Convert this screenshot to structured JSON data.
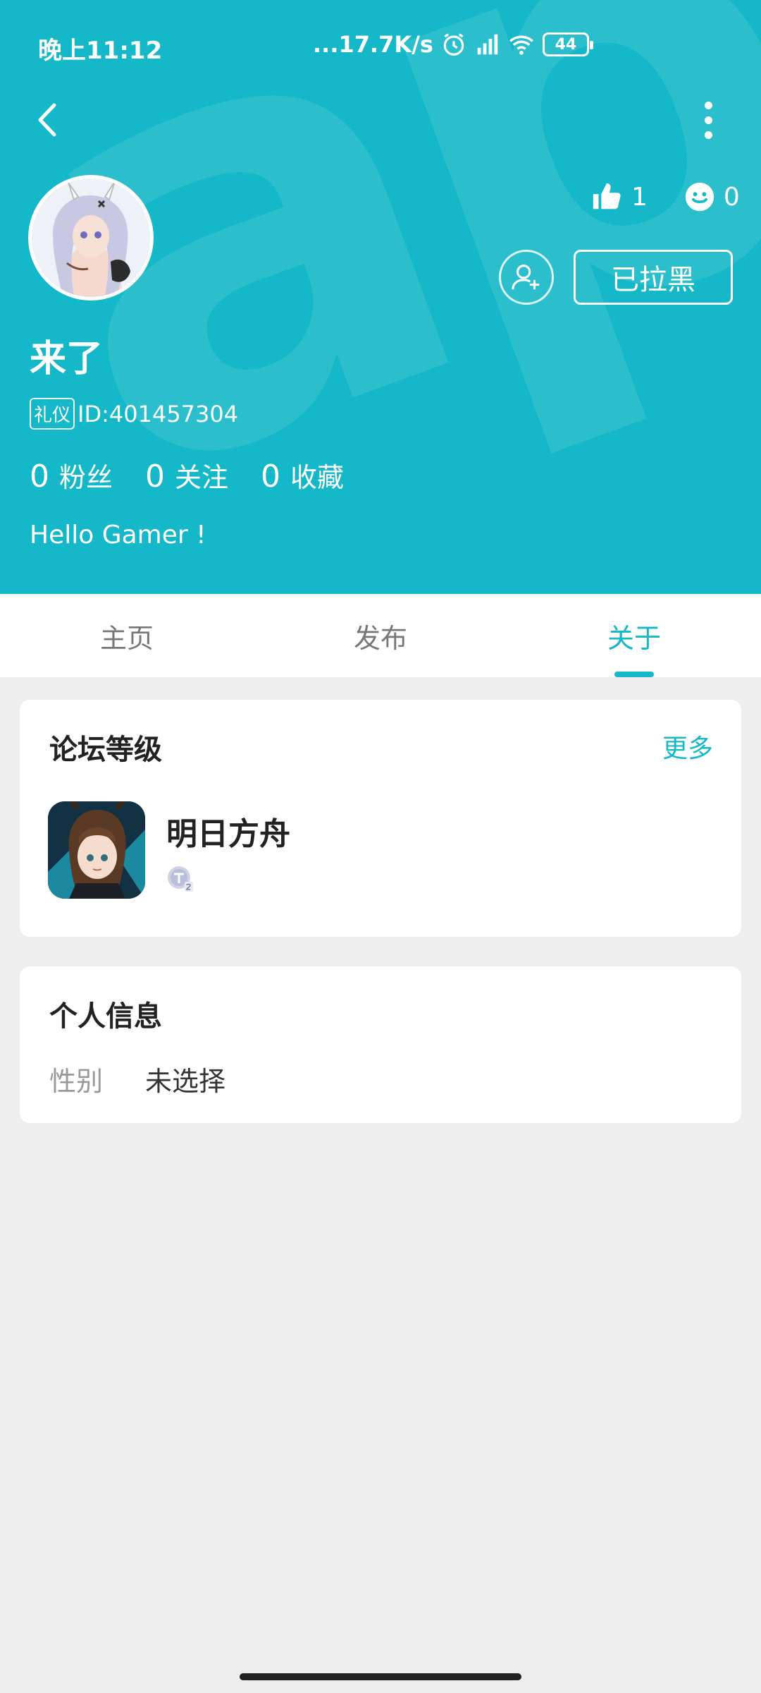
{
  "status_bar": {
    "time": "晚上11:12",
    "net_speed": "...17.7K/s",
    "battery": "44"
  },
  "header": {
    "watermark": "apTap",
    "likes": "1",
    "smiles": "0",
    "blocked_label": "已拉黑",
    "username": "来了",
    "badge": "礼仪",
    "user_id": "ID:401457304",
    "counts": [
      {
        "num": "0",
        "label": "粉丝"
      },
      {
        "num": "0",
        "label": "关注"
      },
      {
        "num": "0",
        "label": "收藏"
      }
    ],
    "bio": "Hello Gamer !"
  },
  "tabs": [
    "主页",
    "发布",
    "关于"
  ],
  "forum_level": {
    "title": "论坛等级",
    "more": "更多",
    "game_name": "明日方舟"
  },
  "personal_info": {
    "title": "个人信息",
    "gender_key": "性别",
    "gender_value": "未选择"
  },
  "colors": {
    "accent": "#14b8c9",
    "background": "#eeeeee"
  }
}
